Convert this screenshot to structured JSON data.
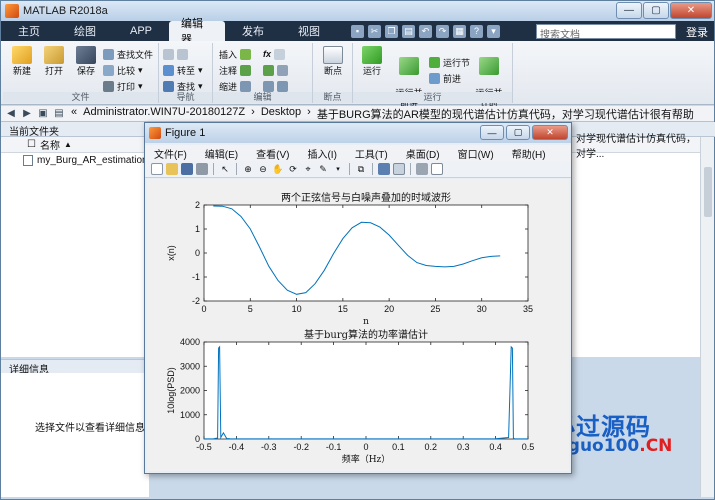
{
  "window": {
    "title": "MATLAB R2018a"
  },
  "tabs": [
    "主页",
    "绘图",
    "APP",
    "编辑器",
    "发布",
    "视图"
  ],
  "active_tab": "编辑器",
  "search": {
    "placeholder": "搜索文档"
  },
  "login": "登录",
  "ribbon": {
    "file": {
      "label": "文件",
      "new": "新建",
      "open": "打开",
      "save": "保存",
      "find_files": "查找文件",
      "compare": "比较",
      "print": "打印"
    },
    "navigate": {
      "label": "导航",
      "goto": "转至",
      "find": "查找"
    },
    "edit": {
      "label": "编辑",
      "insert": "插入",
      "comment": "注释",
      "indent": "缩进",
      "fx": "fx"
    },
    "breakpoints": {
      "label": "断点",
      "breakpoint": "断点"
    },
    "run": {
      "label": "运行",
      "run": "运行",
      "run_advance": "运行并\n前进",
      "run_section": "运行节",
      "advance": "前进",
      "run_time": "运行并\n计时"
    }
  },
  "address": {
    "crumbs": [
      "«",
      "Administrator.WIN7U-20180127Z",
      "›",
      "Desktop",
      "›",
      "基于BURG算法的AR模型的现代谱估计仿真代码，对学习现代谱估计很有帮助"
    ]
  },
  "current_folder": {
    "header": "当前文件夹",
    "column_name": "名称",
    "column_sort": "▲",
    "overflow_text": "对学现代谱估计仿真代码，对学...",
    "files": [
      "my_Burg_AR_estimation.m"
    ]
  },
  "details": {
    "header": "详细信息",
    "message": "选择文件以查看详细信息"
  },
  "figure": {
    "title": "Figure 1",
    "menu": [
      "文件(F)",
      "编辑(E)",
      "查看(V)",
      "插入(I)",
      "工具(T)",
      "桌面(D)",
      "窗口(W)",
      "帮助(H)"
    ]
  },
  "watermark": {
    "text": "必过源码",
    "url_main": "Biguo100",
    "url_tld": ".CN"
  },
  "chart_data": [
    {
      "type": "line",
      "title": "两个正弦信号与白噪声叠加的时域波形",
      "xlabel": "n",
      "ylabel": "x(n)",
      "xlim": [
        0,
        35
      ],
      "ylim": [
        -2,
        2
      ],
      "xticks": [
        0,
        5,
        10,
        15,
        20,
        25,
        30,
        35
      ],
      "yticks": [
        -2,
        -1,
        0,
        1,
        2
      ],
      "series": [
        {
          "x": [
            1,
            2,
            3,
            4,
            5,
            6,
            7,
            8,
            9,
            10,
            11,
            12,
            13,
            14,
            15,
            16,
            17,
            18,
            19,
            20,
            21,
            22,
            23,
            24,
            25,
            26,
            27,
            28,
            29,
            30,
            31,
            32
          ],
          "values": [
            1.96,
            1.95,
            1.84,
            1.52,
            1.0,
            0.25,
            -0.55,
            -1.15,
            -1.55,
            -1.72,
            -1.65,
            -1.28,
            -0.72,
            -0.02,
            0.6,
            1.05,
            1.28,
            1.26,
            1.08,
            0.75,
            0.32,
            -0.1,
            -0.4,
            -0.52,
            -0.56,
            -0.58,
            -0.56,
            -0.46,
            -0.32,
            -0.2,
            -0.14,
            -0.12
          ]
        }
      ],
      "color": "#0072bd"
    },
    {
      "type": "line",
      "title": "基于burg算法的功率谱估计",
      "xlabel": "频率（Hz）",
      "ylabel": "10log(PSD)",
      "xlim": [
        -0.5,
        0.5
      ],
      "ylim": [
        0,
        4000
      ],
      "xticks": [
        -0.5,
        -0.4,
        -0.3,
        -0.2,
        -0.1,
        0,
        0.1,
        0.2,
        0.3,
        0.4,
        0.5
      ],
      "xticklabels": [
        "-0.5",
        "-0.4",
        "-0.3",
        "-0.2",
        "-0.1",
        "0",
        "0.1",
        "0.2",
        "0.3",
        "0.4",
        "0.5"
      ],
      "yticks": [
        0,
        1000,
        2000,
        3000,
        4000
      ],
      "series": [
        {
          "x": [
            -0.5,
            -0.47,
            -0.458,
            -0.455,
            -0.452,
            -0.448,
            -0.44,
            -0.43,
            -0.42,
            -0.3,
            -0.1,
            0.1,
            0.3,
            0.4,
            0.44,
            0.448,
            0.452,
            0.455,
            0.458,
            0.47,
            0.5
          ],
          "values": [
            5,
            8,
            40,
            3750,
            3800,
            60,
            250,
            20,
            8,
            3,
            3,
            3,
            3,
            8,
            60,
            3800,
            3750,
            40,
            8,
            5,
            5
          ]
        }
      ],
      "color": "#0072bd"
    }
  ]
}
